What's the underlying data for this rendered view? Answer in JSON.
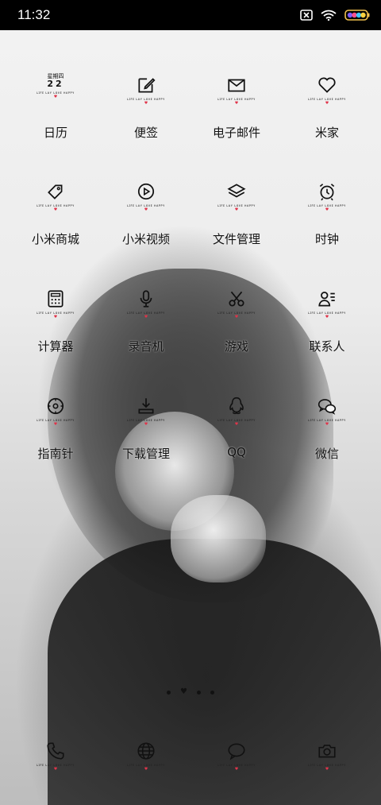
{
  "status_bar": {
    "time": "11:32",
    "icons": [
      "sim-off-icon",
      "wifi-icon",
      "battery-icon"
    ]
  },
  "icon_caption": "ʟɪꜰᴇ ʟᴀʏ ʟᴏᴠᴇ ʜᴀᴘᴘʏ",
  "calendar": {
    "weekday": "星期四",
    "day": "22"
  },
  "apps": [
    {
      "label": "日历",
      "icon": "calendar-icon"
    },
    {
      "label": "便签",
      "icon": "notes-icon"
    },
    {
      "label": "电子邮件",
      "icon": "mail-icon"
    },
    {
      "label": "米家",
      "icon": "heart-icon"
    },
    {
      "label": "小米商城",
      "icon": "tag-icon"
    },
    {
      "label": "小米视频",
      "icon": "video-play-icon"
    },
    {
      "label": "文件管理",
      "icon": "layers-icon"
    },
    {
      "label": "时钟",
      "icon": "alarm-clock-icon"
    },
    {
      "label": "计算器",
      "icon": "calculator-icon"
    },
    {
      "label": "录音机",
      "icon": "microphone-icon"
    },
    {
      "label": "游戏",
      "icon": "scissors-icon"
    },
    {
      "label": "联系人",
      "icon": "contacts-icon"
    },
    {
      "label": "指南针",
      "icon": "compass-icon"
    },
    {
      "label": "下载管理",
      "icon": "download-icon"
    },
    {
      "label": "QQ",
      "icon": "qq-penguin-icon"
    },
    {
      "label": "微信",
      "icon": "wechat-icon"
    }
  ],
  "page_indicator": {
    "pages": 4,
    "current": 2
  },
  "dock": [
    {
      "icon": "phone-icon"
    },
    {
      "icon": "browser-globe-icon"
    },
    {
      "icon": "message-bubble-icon"
    },
    {
      "icon": "camera-icon"
    }
  ],
  "colors": {
    "status_bar_bg": "#000000",
    "accent_heart": "#e0344a",
    "icon_stroke": "#111111"
  }
}
